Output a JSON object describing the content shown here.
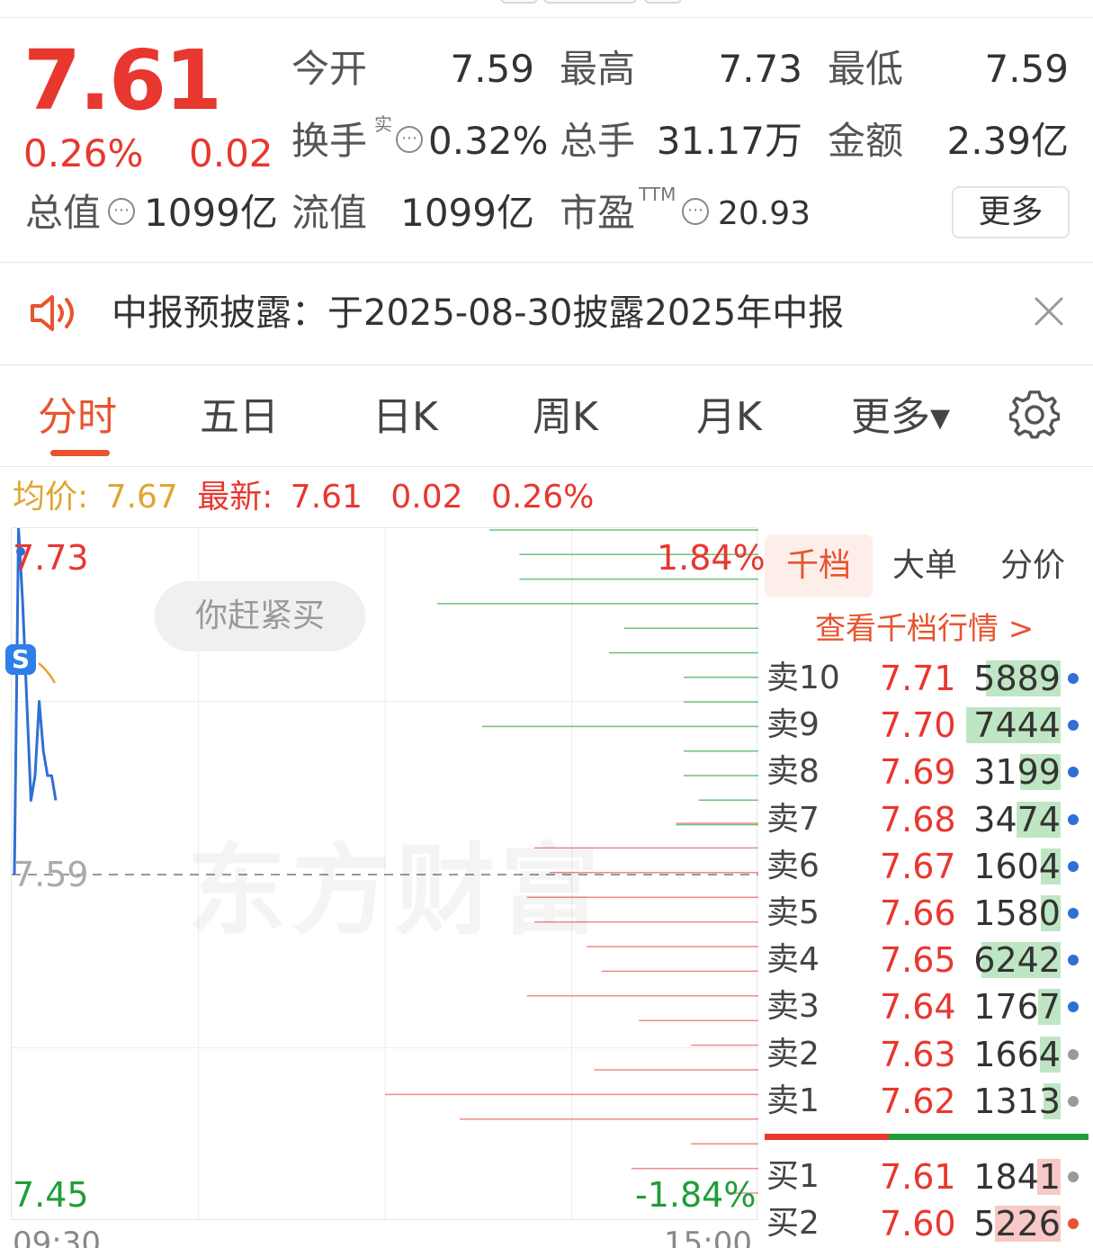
{
  "quote": {
    "price": "7.61",
    "change_pct": "0.26%",
    "change": "0.02",
    "open_label": "今开",
    "open_val": "7.59",
    "high_label": "最高",
    "high_val": "7.73",
    "low_label": "最低",
    "low_val": "7.59",
    "turnover_label": "换手",
    "turnover_sup": "实",
    "turnover_val": "0.32%",
    "volume_label": "总手",
    "volume_val": "31.17万",
    "amount_label": "金额",
    "amount_val": "2.39亿",
    "mktcap_label": "总值",
    "mktcap_val": "1099亿",
    "float_label": "流值",
    "float_val": "1099亿",
    "pe_label": "市盈",
    "pe_sup": "TTM",
    "pe_val": "20.93",
    "more_label": "更多",
    "info_glyph": "⋯"
  },
  "notice": {
    "text": "中报预披露：于2025-08-30披露2025年中报"
  },
  "tabs": [
    "分时",
    "五日",
    "日K",
    "周K",
    "月K",
    "更多▾"
  ],
  "avg_line": {
    "avg_label": "均价:",
    "avg_val": "7.67",
    "latest_label": "最新:",
    "latest_val": "7.61",
    "chg": "0.02",
    "pct": "0.26%"
  },
  "chart": {
    "top_price": "7.73",
    "mid_price": "7.59",
    "bottom_price": "7.45",
    "top_pct": "1.84%",
    "bottom_pct": "-1.84%",
    "start_time": "09:30",
    "end_time": "15:00",
    "pill_text": "你赶紧买",
    "watermark": "东方财富",
    "s_badge": "S"
  },
  "chart_data": {
    "type": "line",
    "ylim": [
      7.45,
      7.73
    ],
    "series": [
      {
        "values": [
          7.59,
          7.73,
          7.7,
          7.66,
          7.62,
          7.63,
          7.66,
          7.64,
          7.63,
          7.63,
          7.62
        ]
      }
    ],
    "depth_bars_green": [
      0.36,
      0.32,
      0.32,
      0.43,
      0.18,
      0.2,
      0.1,
      0.1,
      0.37,
      0.1,
      0.1,
      0.08,
      0.11
    ],
    "depth_bars_red": [
      0.11,
      0.3,
      0.28,
      0.31,
      0.3,
      0.23,
      0.21,
      0.31,
      0.16,
      0.09,
      0.22,
      0.5,
      0.4,
      0.09,
      0.17,
      0.04
    ]
  },
  "order_book": {
    "tabs": [
      "千档",
      "大单",
      "分价"
    ],
    "link": "查看千档行情 >",
    "asks": [
      {
        "label": "卖10",
        "price": "7.71",
        "vol": "5889",
        "bar": 0.79,
        "dot": "#2f6fd6"
      },
      {
        "label": "卖9",
        "price": "7.70",
        "vol": "7444",
        "bar": 1.0,
        "dot": "#2f6fd6"
      },
      {
        "label": "卖8",
        "price": "7.69",
        "vol": "3199",
        "bar": 0.43,
        "dot": "#2f6fd6"
      },
      {
        "label": "卖7",
        "price": "7.68",
        "vol": "3474",
        "bar": 0.47,
        "dot": "#2f6fd6"
      },
      {
        "label": "卖6",
        "price": "7.67",
        "vol": "1604",
        "bar": 0.21,
        "dot": "#2f6fd6"
      },
      {
        "label": "卖5",
        "price": "7.66",
        "vol": "1580",
        "bar": 0.21,
        "dot": "#2f6fd6"
      },
      {
        "label": "卖4",
        "price": "7.65",
        "vol": "6242",
        "bar": 0.84,
        "dot": "#2f6fd6"
      },
      {
        "label": "卖3",
        "price": "7.64",
        "vol": "1767",
        "bar": 0.24,
        "dot": "#2f6fd6"
      },
      {
        "label": "卖2",
        "price": "7.63",
        "vol": "1664",
        "bar": 0.22,
        "dot": "#9a9a9a"
      },
      {
        "label": "卖1",
        "price": "7.62",
        "vol": "1313",
        "bar": 0.18,
        "dot": "#9a9a9a"
      }
    ],
    "bids": [
      {
        "label": "买1",
        "price": "7.61",
        "vol": "1841",
        "bar": 0.25,
        "dot": "#9a9a9a"
      },
      {
        "label": "买2",
        "price": "7.60",
        "vol": "5226",
        "bar": 0.7,
        "dot": "#e8542f"
      }
    ],
    "buy_sell_split": 0.4
  },
  "colors": {
    "up": "#e8372f",
    "down": "#1f9d3a",
    "accent": "#e8542f",
    "avg": "#e0a531",
    "line": "#2f6fd6"
  }
}
